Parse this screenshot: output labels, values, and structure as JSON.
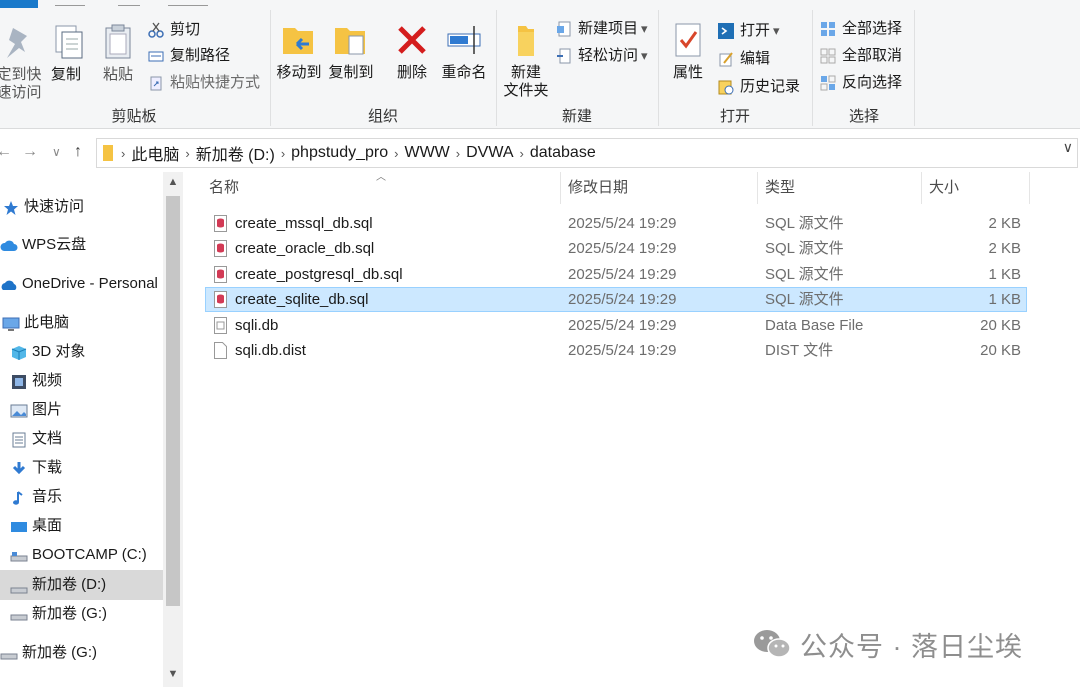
{
  "ribbon": {
    "clipboard": {
      "pin_label": "定到快\n速访问",
      "copy_label": "复制",
      "paste_label": "粘贴",
      "cut_label": "剪切",
      "copy_path_label": "复制路径",
      "paste_shortcut_label": "粘贴快捷方式",
      "group_label": "剪贴板"
    },
    "organize": {
      "move_to_label": "移动到",
      "copy_to_label": "复制到",
      "delete_label": "删除",
      "rename_label": "重命名",
      "group_label": "组织"
    },
    "new": {
      "new_folder_label": "新建\n文件夹",
      "new_item_label": "新建项目",
      "easy_access_label": "轻松访问",
      "group_label": "新建"
    },
    "open": {
      "properties_label": "属性",
      "open_label": "打开",
      "edit_label": "编辑",
      "history_label": "历史记录",
      "group_label": "打开"
    },
    "select": {
      "select_all_label": "全部选择",
      "select_none_label": "全部取消",
      "invert_label": "反向选择",
      "group_label": "选择"
    }
  },
  "address": {
    "crumbs": [
      "此电脑",
      "新加卷 (D:)",
      "phpstudy_pro",
      "WWW",
      "DVWA",
      "database"
    ]
  },
  "sidebar": {
    "items": [
      {
        "label": "快速访问",
        "icon": "star-icon"
      },
      {
        "label": "WPS云盘",
        "icon": "cloud-icon"
      },
      {
        "label": "OneDrive - Personal",
        "icon": "onedrive-icon"
      },
      {
        "label": "此电脑",
        "icon": "computer-icon"
      },
      {
        "label": "3D 对象",
        "icon": "cube-icon"
      },
      {
        "label": "视频",
        "icon": "video-icon"
      },
      {
        "label": "图片",
        "icon": "picture-icon"
      },
      {
        "label": "文档",
        "icon": "document-icon"
      },
      {
        "label": "下载",
        "icon": "download-icon"
      },
      {
        "label": "音乐",
        "icon": "music-icon"
      },
      {
        "label": "桌面",
        "icon": "desktop-icon"
      },
      {
        "label": "BOOTCAMP (C:)",
        "icon": "drive-icon"
      },
      {
        "label": "新加卷 (D:)",
        "icon": "drive-icon"
      },
      {
        "label": "新加卷 (G:)",
        "icon": "drive-icon"
      },
      {
        "label": "新加卷 (G:)",
        "icon": "drive-icon"
      }
    ]
  },
  "list": {
    "columns": {
      "name": "名称",
      "date": "修改日期",
      "type": "类型",
      "size": "大小"
    },
    "files": [
      {
        "name": "create_mssql_db.sql",
        "date": "2025/5/24 19:29",
        "type": "SQL 源文件",
        "size": "2 KB",
        "icon": "sql-file-icon"
      },
      {
        "name": "create_oracle_db.sql",
        "date": "2025/5/24 19:29",
        "type": "SQL 源文件",
        "size": "2 KB",
        "icon": "sql-file-icon"
      },
      {
        "name": "create_postgresql_db.sql",
        "date": "2025/5/24 19:29",
        "type": "SQL 源文件",
        "size": "1 KB",
        "icon": "sql-file-icon"
      },
      {
        "name": "create_sqlite_db.sql",
        "date": "2025/5/24 19:29",
        "type": "SQL 源文件",
        "size": "1 KB",
        "icon": "sql-file-icon"
      },
      {
        "name": "sqli.db",
        "date": "2025/5/24 19:29",
        "type": "Data Base File",
        "size": "20 KB",
        "icon": "db-file-icon"
      },
      {
        "name": "sqli.db.dist",
        "date": "2025/5/24 19:29",
        "type": "DIST 文件",
        "size": "20 KB",
        "icon": "blank-file-icon"
      }
    ],
    "selected_index": 3
  },
  "watermark": "公众号 · 落日尘埃",
  "colors": {
    "accent": "#1979ca",
    "selection": "#cce8ff",
    "sql_icon": "#d23a55"
  }
}
